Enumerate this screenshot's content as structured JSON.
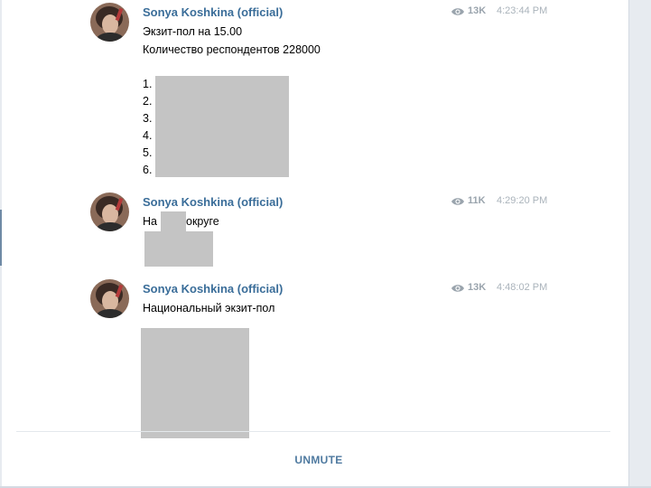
{
  "messages": [
    {
      "author": "Sonya Koshkina (official)",
      "views": "13K",
      "time": "4:23:44 PM",
      "lines": [
        "Экзит-пол на 15.00",
        "Количество респондентов 228000"
      ],
      "list_numbers": [
        "1.",
        "2.",
        "3.",
        "4.",
        "5.",
        "6."
      ]
    },
    {
      "author": "Sonya Koshkina (official)",
      "views": "11K",
      "time": "4:29:20 PM",
      "line_start": "На",
      "line_end": "округе"
    },
    {
      "author": "Sonya Koshkina (official)",
      "views": "13K",
      "time": "4:48:02 PM",
      "lines": [
        "Национальный экзит-пол"
      ]
    }
  ],
  "footer": {
    "unmute_label": "UNMUTE"
  },
  "colors": {
    "author": "#3a6d99",
    "meta": "#9aa4ad",
    "redaction": "#c4c4c4",
    "accent": "#4f7aa0"
  },
  "icons": {
    "views": "eye-icon"
  }
}
